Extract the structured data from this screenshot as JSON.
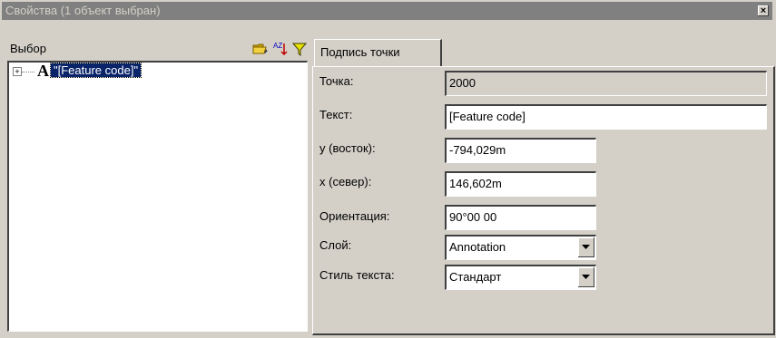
{
  "window": {
    "title": "Свойства (1 объект выбран)",
    "close_glyph": "×"
  },
  "selection_panel": {
    "header_label": "Выбор",
    "icons": [
      "folder-icon",
      "sort-az-icon",
      "filter-icon"
    ],
    "sort_icon_text": "AZ",
    "tree": {
      "expander": "+",
      "type_glyph": "A",
      "node_label": "\"[Feature code]\""
    }
  },
  "properties": {
    "tab_label": "Подпись точки",
    "fields": [
      {
        "label": "Точка:",
        "value": "2000",
        "readonly": true
      },
      {
        "label": "Текст:",
        "value": "[Feature code]"
      },
      {
        "label": "y (восток):",
        "value": "-794,029m"
      },
      {
        "label": "x (север):",
        "value": "146,602m"
      },
      {
        "label": "Ориентация:",
        "value": "90°00 00"
      }
    ],
    "combos": [
      {
        "label": "Слой:",
        "value": "Annotation"
      },
      {
        "label": "Стиль текста:",
        "value": "Стандарт"
      }
    ]
  },
  "colors": {
    "face": "#d4d0c8",
    "titlebar": "#808080",
    "selection": "#0a246a"
  }
}
